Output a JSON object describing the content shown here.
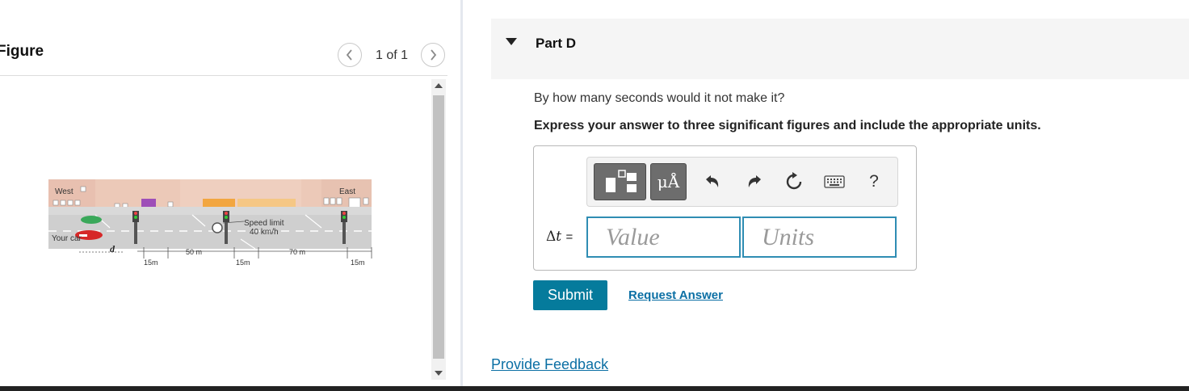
{
  "figure_pane": {
    "title": "Figure",
    "pagination": "1 of 1",
    "prev_icon": "chevron-left-icon",
    "next_icon": "chevron-right-icon",
    "image_labels": {
      "west": "West",
      "east": "East",
      "your_car": "Your car",
      "distance_var": "d",
      "speed_limit": "Speed limit",
      "speed_value": "40 km/h",
      "dist_1": "15m",
      "dist_2": "50 m",
      "dist_3": "15m",
      "dist_4": "70 m",
      "dist_5": "15m"
    }
  },
  "part": {
    "title": "Part D",
    "caret_icon": "caret-down-icon",
    "question": "By how many seconds would it not make it?",
    "instructions": "Express your answer to three significant figures and include the appropriate units."
  },
  "toolbar": {
    "templates_icon": "templates-icon",
    "units_label": "μÅ",
    "undo_icon": "undo-icon",
    "redo_icon": "redo-icon",
    "reset_icon": "reset-icon",
    "keyboard_icon": "keyboard-icon",
    "help_label": "?"
  },
  "answer": {
    "variable_symbol": "Δ",
    "variable_name": "t",
    "equals": "=",
    "value_placeholder": "Value",
    "units_placeholder": "Units"
  },
  "actions": {
    "submit_label": "Submit",
    "request_answer_label": "Request Answer",
    "provide_feedback_label": "Provide Feedback"
  },
  "colors": {
    "accent": "#057b9c",
    "input_border": "#2f8db3",
    "link": "#0b6fa4"
  }
}
